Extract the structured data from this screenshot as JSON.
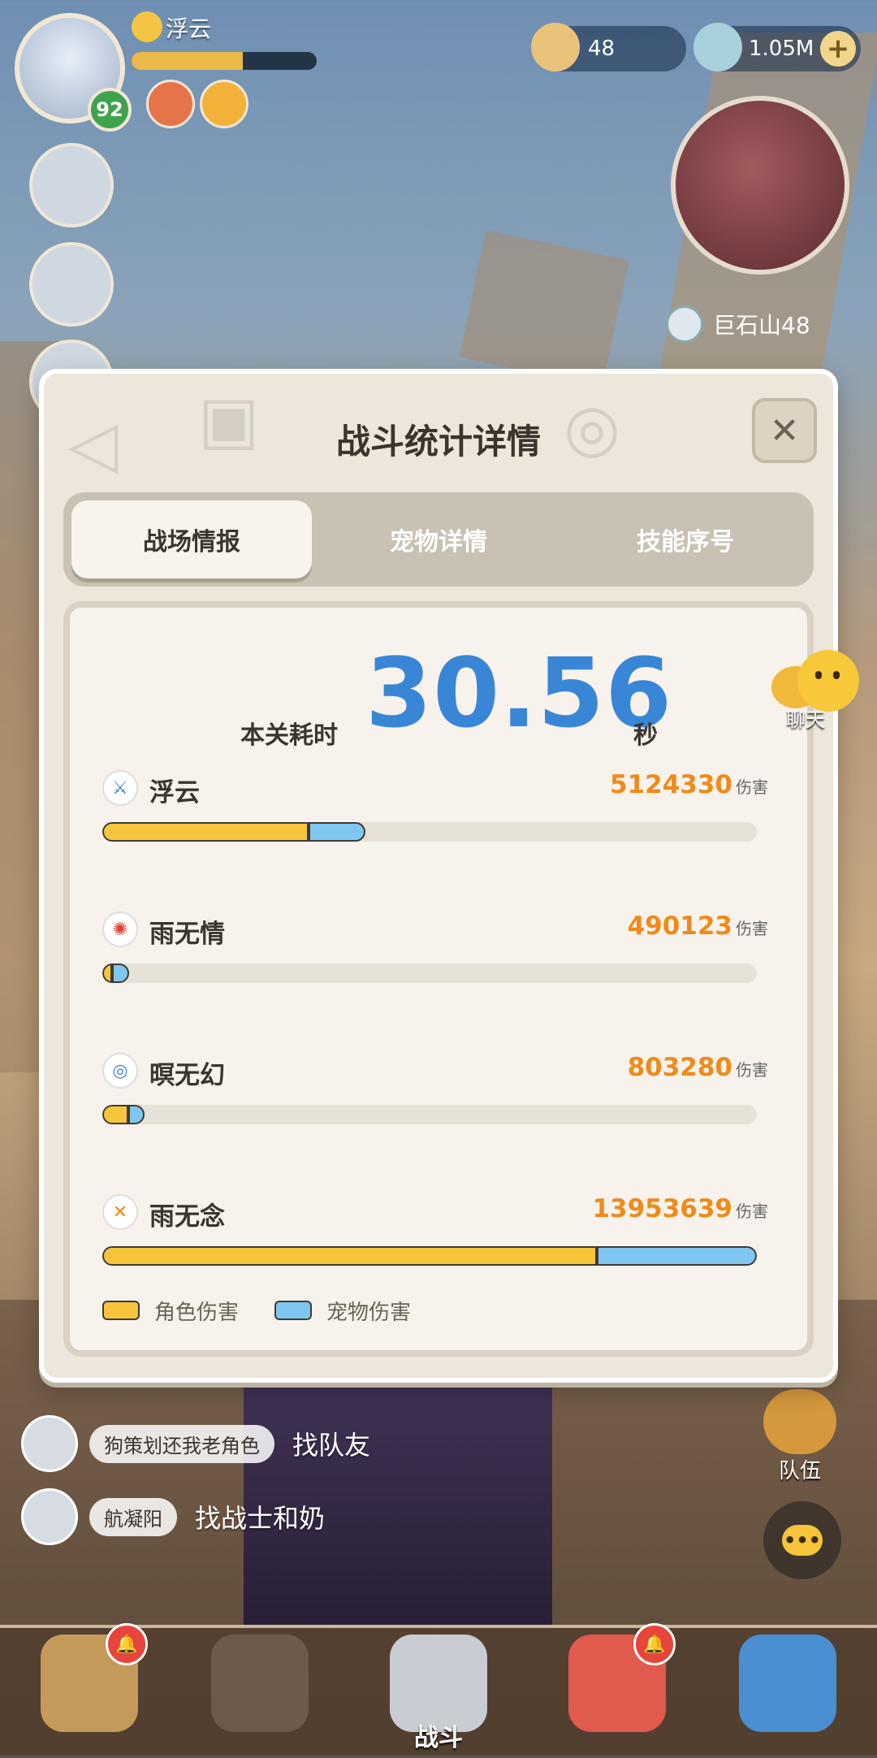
{
  "hud": {
    "player_name": "浮云",
    "level": "92",
    "hp_fraction": 0.6,
    "shell_count": "48",
    "gem_count": "1.05M",
    "plus": "+",
    "map_location": "巨石山48"
  },
  "dialog": {
    "title": "战斗统计详情",
    "close": "✕",
    "tabs": [
      "战场情报",
      "宠物详情",
      "技能序号"
    ],
    "time_label": "本关耗时",
    "time_value": "30.56",
    "time_unit": "秒",
    "damage_unit": "伤害",
    "rows": [
      {
        "name": "浮云",
        "damage": "5124330",
        "role_fraction": 0.315,
        "pet_fraction": 0.087,
        "icon": "sword-icon",
        "icon_color": "#3a86d6"
      },
      {
        "name": "雨无情",
        "damage": "490123",
        "role_fraction": 0.015,
        "pet_fraction": 0.026,
        "icon": "flame-icon",
        "icon_color": "#e0413a"
      },
      {
        "name": "暝无幻",
        "damage": "803280",
        "role_fraction": 0.04,
        "pet_fraction": 0.024,
        "icon": "swirl-icon",
        "icon_color": "#3a86d6"
      },
      {
        "name": "雨无念",
        "damage": "13953639",
        "role_fraction": 0.755,
        "pet_fraction": 0.245,
        "icon": "blade-icon",
        "icon_color": "#ee8b1a"
      }
    ],
    "legend": {
      "role": "角色伤害",
      "pet": "宠物伤害"
    },
    "colors": {
      "role": "#f6c53b",
      "pet": "#7fc6f1",
      "time": "#3a86d6",
      "damage": "#ee8b1a"
    }
  },
  "chat_float": {
    "label": "聊天"
  },
  "chat_log": [
    {
      "name": "狗策划还我老角色",
      "message": "找队友"
    },
    {
      "name": "航凝阳",
      "message": "找战士和奶"
    }
  ],
  "team": {
    "label": "队伍"
  },
  "bottom_nav": [
    {
      "label": "",
      "icon": "beast-icon",
      "alert": true
    },
    {
      "label": "",
      "icon": "hero-icon",
      "alert": false
    },
    {
      "label": "战斗",
      "icon": "battle-icon",
      "alert": false
    },
    {
      "label": "",
      "icon": "pet-icon",
      "alert": true
    },
    {
      "label": "",
      "icon": "banner-icon",
      "alert": false
    }
  ]
}
